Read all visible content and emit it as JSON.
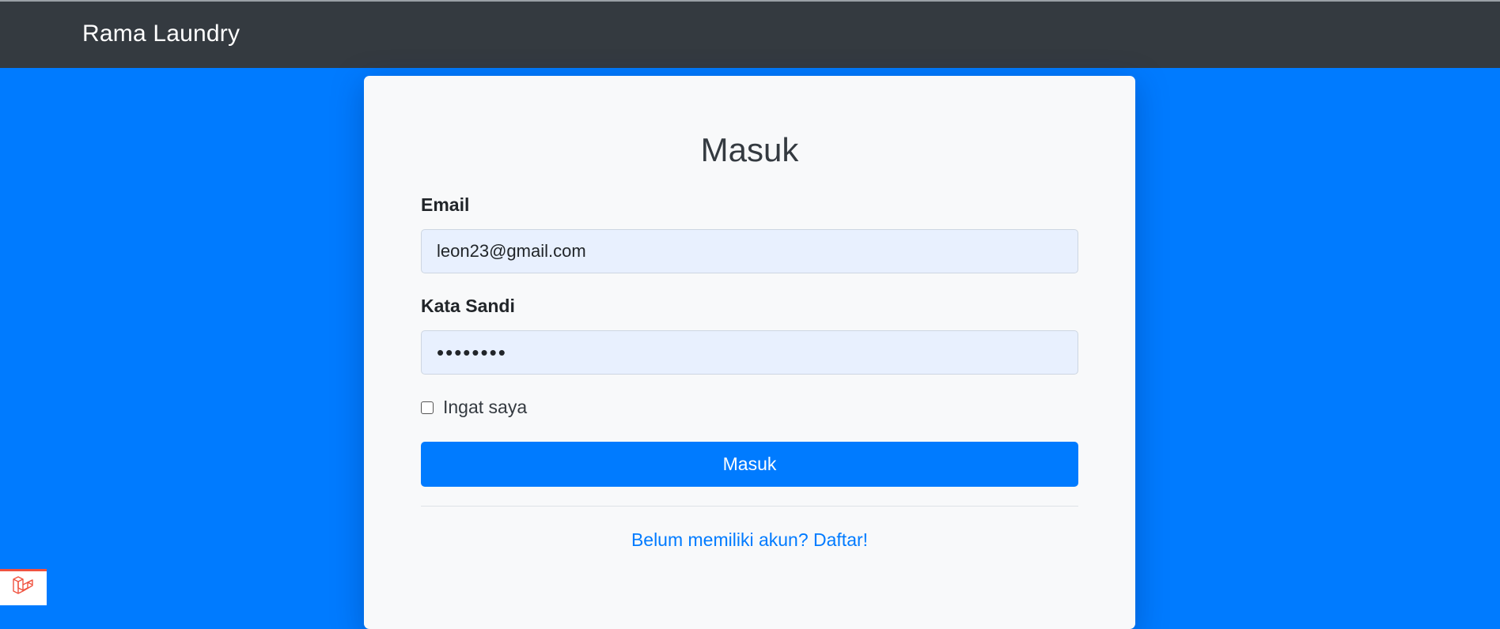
{
  "navbar": {
    "brand": "Rama Laundry"
  },
  "login_card": {
    "title": "Masuk",
    "email": {
      "label": "Email",
      "value": "leon23@gmail.com"
    },
    "password": {
      "label": "Kata Sandi",
      "value": "••••••••"
    },
    "remember": {
      "label": "Ingat saya",
      "checked": false
    },
    "submit_label": "Masuk",
    "register_link": "Belum memiliki akun? Daftar!"
  },
  "colors": {
    "page_background": "#007bff",
    "navbar": "#343a40",
    "card": "#f8f9fa",
    "primary": "#007bff",
    "input_background": "#e8f0fe",
    "debug_accent": "#f05340"
  },
  "icons": {
    "debug_badge": "laravel-icon"
  }
}
